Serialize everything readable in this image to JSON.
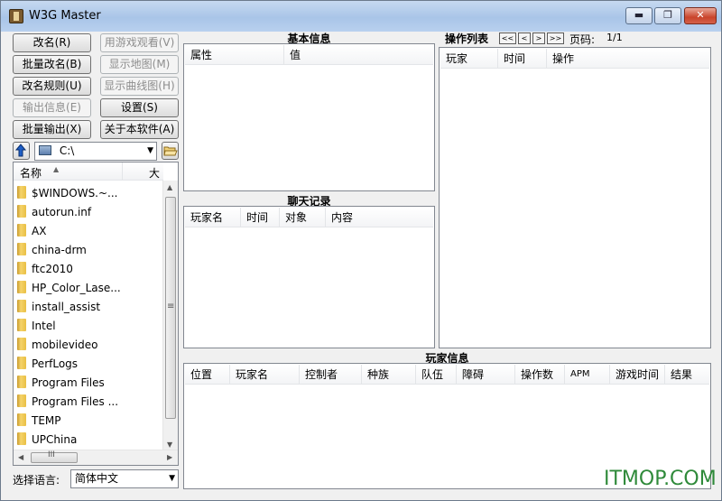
{
  "window": {
    "title": "W3G Master",
    "min": "▬",
    "max": "❐",
    "close": "✕"
  },
  "left_buttons": {
    "rename": "改名(R)",
    "watch": "用游戏观看(V)",
    "batch_rename": "批量改名(B)",
    "show_map": "显示地图(M)",
    "rename_rule": "改名规则(U)",
    "show_curve": "显示曲线图(H)",
    "export_info": "输出信息(E)",
    "settings": "设置(S)",
    "batch_export": "批量输出(X)",
    "about": "关于本软件(A)"
  },
  "drive": {
    "up_icon": "up-arrow-icon",
    "value": "C:\\",
    "open_icon": "folder-open-icon"
  },
  "file_list": {
    "headers": [
      "名称",
      "大"
    ],
    "items": [
      "$WINDOWS.~...",
      "autorun.inf",
      "AX",
      "china-drm",
      "ftc2010",
      "HP_Color_Lase...",
      "install_assist",
      "Intel",
      "mobilevideo",
      "PerfLogs",
      "Program Files",
      "Program Files ...",
      "TEMP",
      "UPChina"
    ],
    "hscroll_label": "III",
    "vscroll_grip": "≡"
  },
  "language": {
    "label": "选择语言:",
    "value": "简体中文"
  },
  "basic_info": {
    "title": "基本信息",
    "headers": [
      "属性",
      "值"
    ]
  },
  "chat": {
    "title": "聊天记录",
    "headers": [
      "玩家名",
      "时间",
      "对象",
      "内容"
    ]
  },
  "ops": {
    "title": "操作列表",
    "nav": [
      "<<",
      "<",
      ">",
      ">>"
    ],
    "page_label": "页码:",
    "page_value": "1/1",
    "headers": [
      "玩家",
      "时间",
      "操作"
    ]
  },
  "players": {
    "title": "玩家信息",
    "headers": [
      "位置",
      "玩家名",
      "控制者",
      "种族",
      "队伍",
      "障碍",
      "操作数",
      "APM",
      "游戏时间",
      "结果"
    ]
  },
  "watermark": "ITMOP.COM"
}
